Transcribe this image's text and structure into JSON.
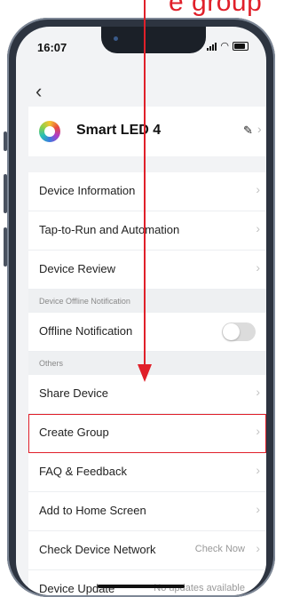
{
  "caption": "e group",
  "status_bar": {
    "time": "16:07"
  },
  "header": {
    "device_name": "Smart LED 4"
  },
  "rows": {
    "device_information": "Device Information",
    "tap_to_run": "Tap-to-Run and Automation",
    "device_review": "Device Review",
    "offline_section": "Device Offline Notification",
    "offline_notification": "Offline Notification",
    "others_section": "Others",
    "share_device": "Share Device",
    "create_group": "Create Group",
    "faq": "FAQ & Feedback",
    "add_home": "Add to Home Screen",
    "check_network": "Check Device Network",
    "check_now": "Check Now",
    "device_update": "Device Update",
    "no_updates": "No updates available"
  },
  "offline_toggle_on": false,
  "icons": [
    "back-chevron-icon",
    "edit-pencil-icon",
    "chevron-right-icon",
    "signal-icon",
    "wifi-icon",
    "battery-icon"
  ],
  "colors": {
    "annotation": "#e0202a",
    "toggle_off": "#dcdcdc",
    "background": "#f2f3f5"
  }
}
